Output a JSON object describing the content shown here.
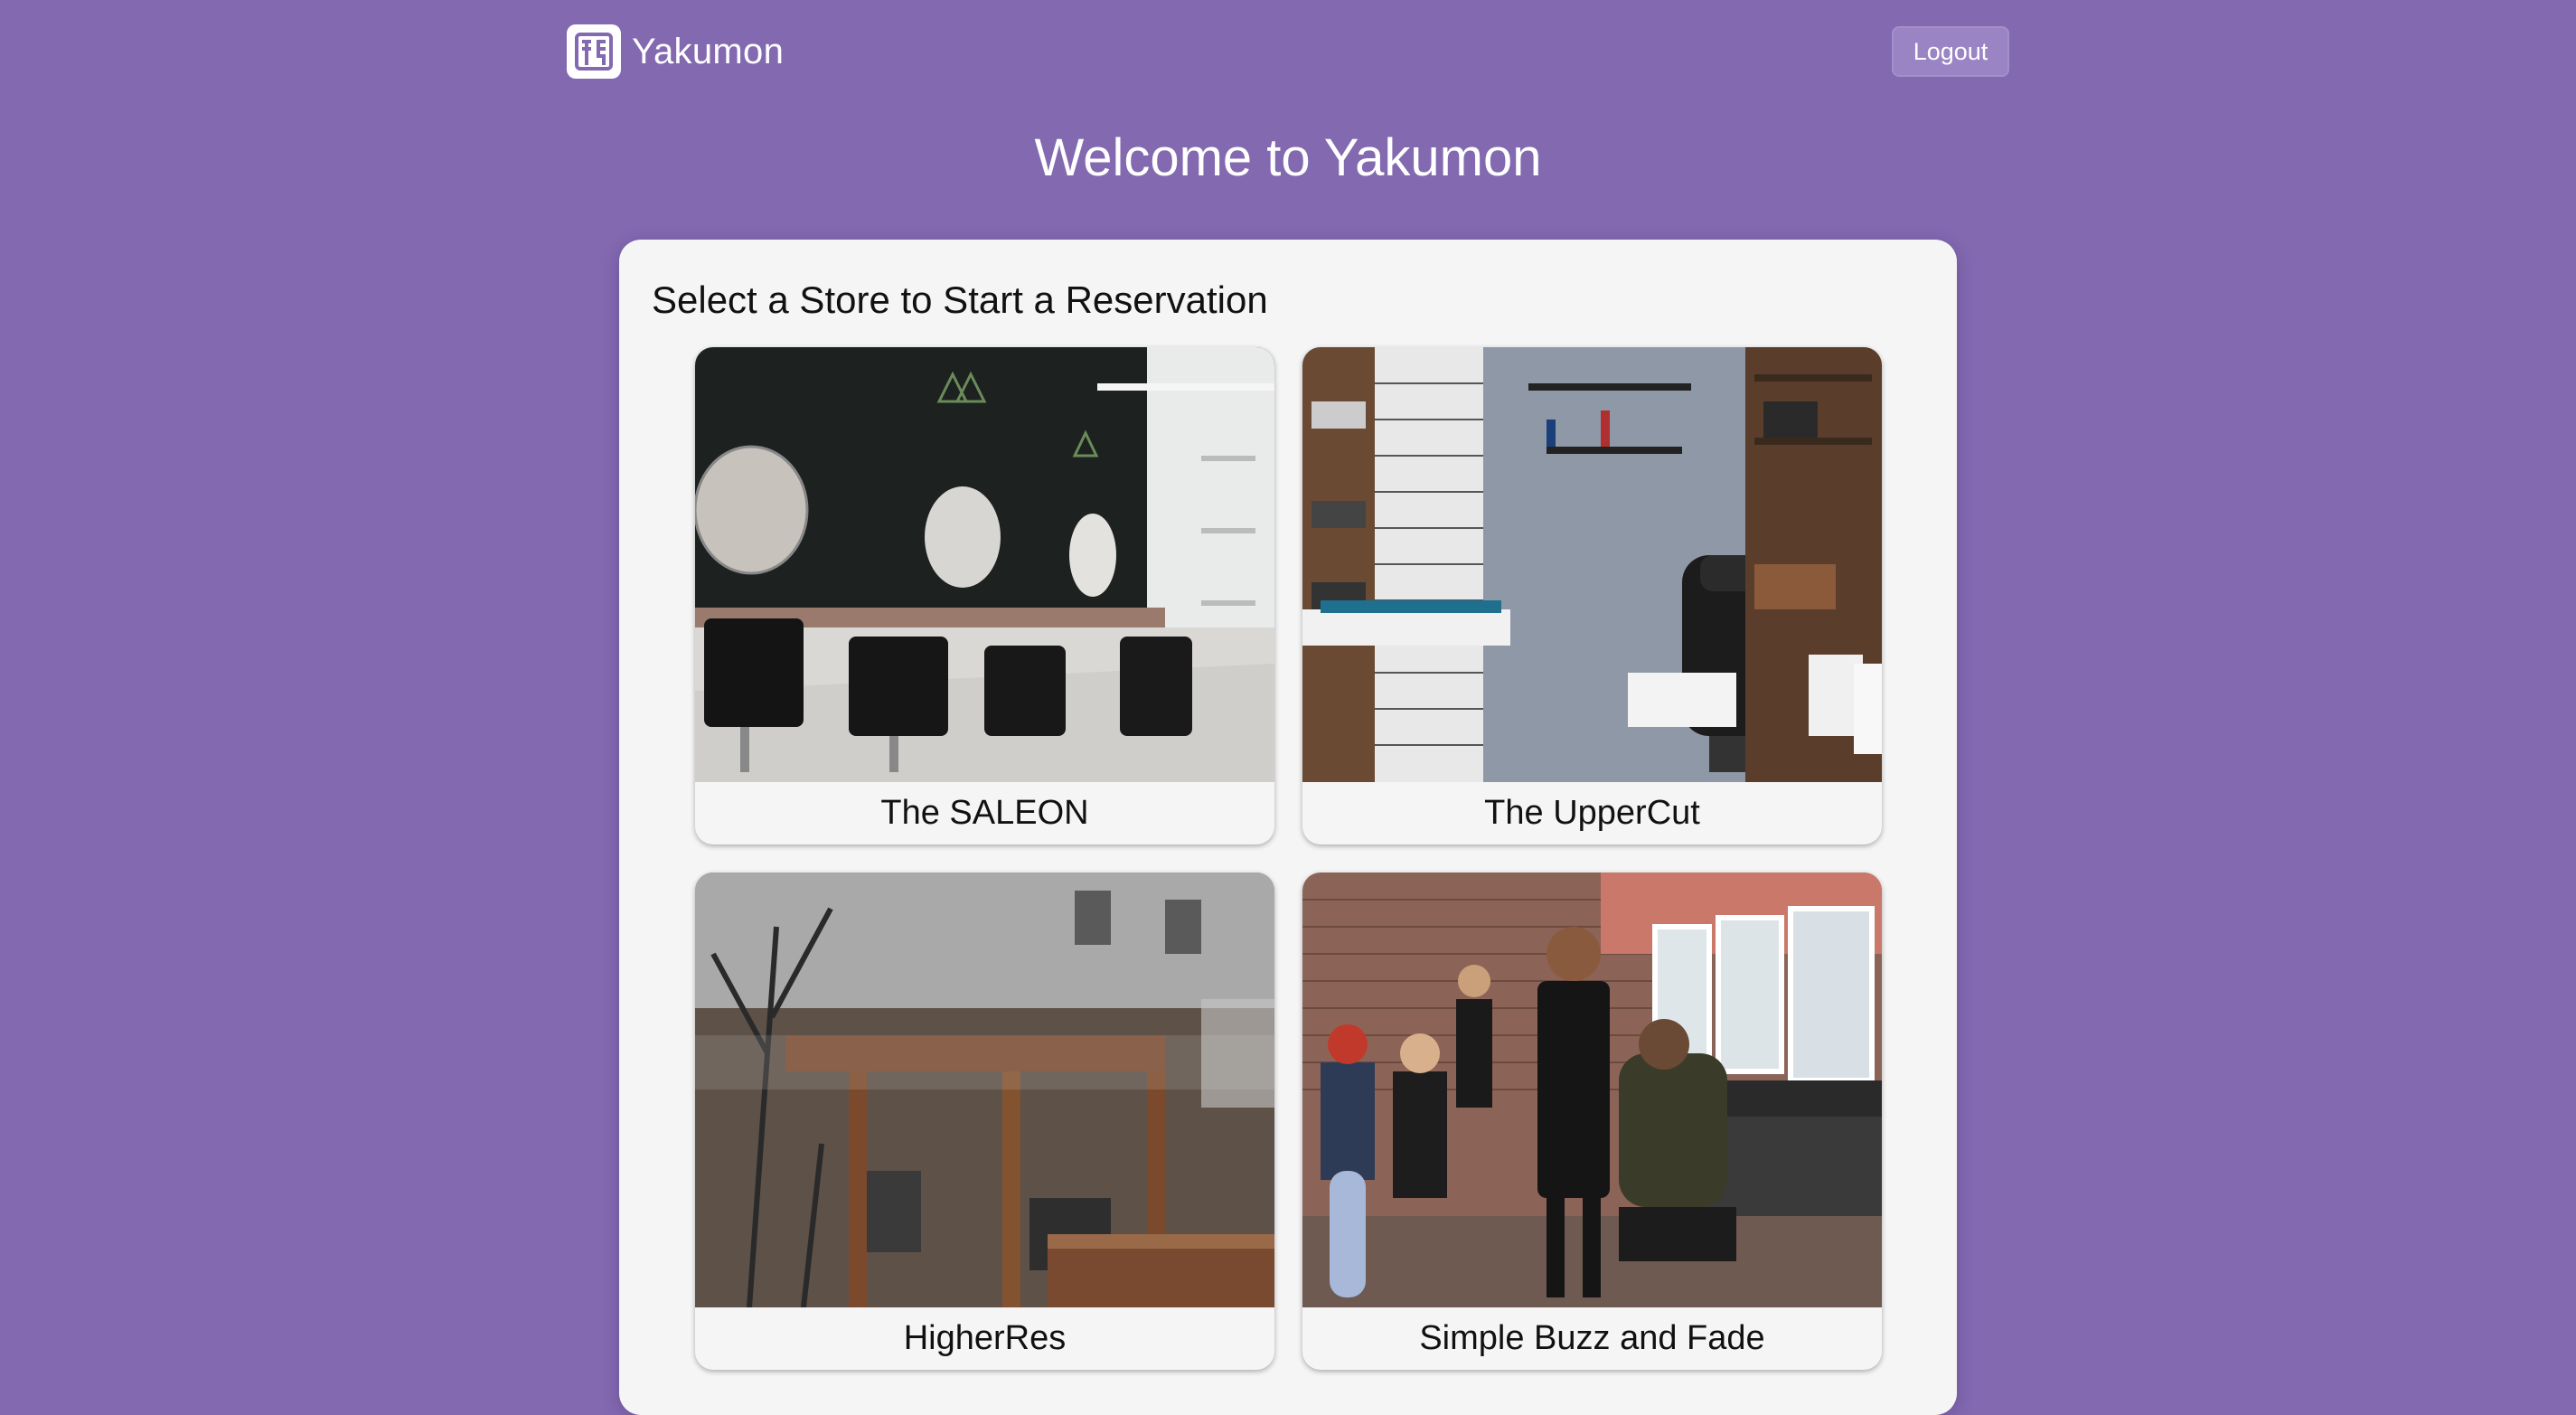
{
  "header": {
    "brand_name": "Yakumon",
    "logo_icon": "yakumon-logo-icon",
    "logout_label": "Logout"
  },
  "page": {
    "title": "Welcome to Yakumon"
  },
  "stores": {
    "heading": "Select a Store to Start a Reservation",
    "items": [
      {
        "name": "The SALEON",
        "image": "salon-interior-photo"
      },
      {
        "name": "The UpperCut",
        "image": "barber-chair-photo"
      },
      {
        "name": "HigherRes",
        "image": "street-storefront-photo"
      },
      {
        "name": "Simple Buzz and Fade",
        "image": "busy-barbershop-photo"
      }
    ]
  },
  "colors": {
    "background": "#8369b0",
    "panel": "#f5f5f5",
    "text": "#111111",
    "header_text": "#ffffff"
  }
}
